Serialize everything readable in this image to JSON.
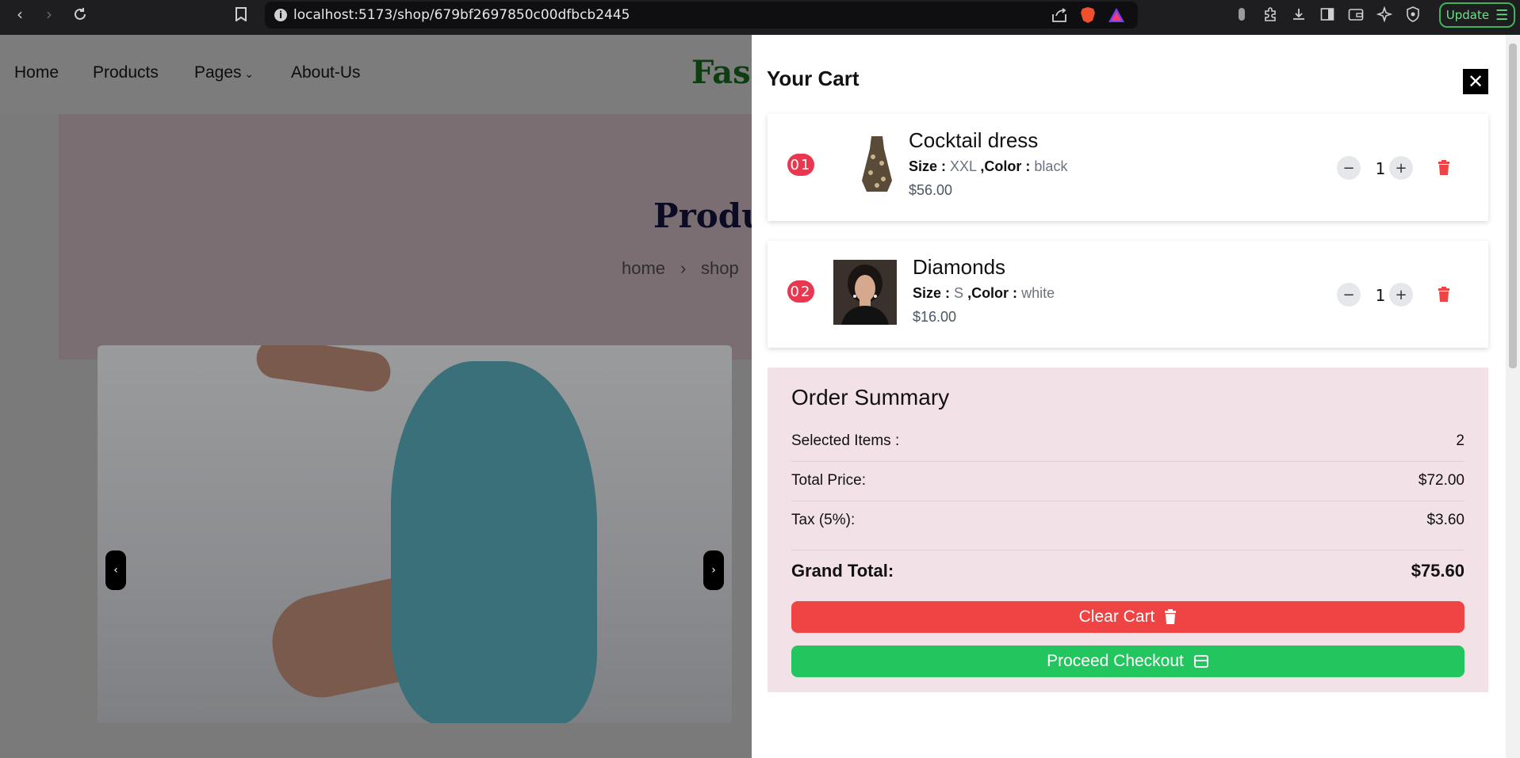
{
  "browser": {
    "url_host": "localhost",
    "url_rest": ":5173/shop/679bf2697850c00dfbcb2445",
    "update_label": "Update"
  },
  "nav": {
    "home": "Home",
    "products": "Products",
    "pages": "Pages",
    "about": "About-Us",
    "logo": "Fash"
  },
  "hero": {
    "title": "Produc",
    "breadcrumb_home": "home",
    "breadcrumb_sep": "›",
    "breadcrumb_shop": "shop"
  },
  "slider": {
    "prev": "‹",
    "next": "›"
  },
  "cart": {
    "title": "Your Cart",
    "items": [
      {
        "index": "01",
        "name": "Cocktail dress",
        "size_label": "Size :",
        "size": "XXL",
        "color_label": ",Color :",
        "color": "black",
        "price": "$56.00",
        "qty": "1"
      },
      {
        "index": "02",
        "name": "Diamonds",
        "size_label": "Size :",
        "size": "S",
        "color_label": ",Color :",
        "color": "white",
        "price": "$16.00",
        "qty": "1"
      }
    ],
    "qty_minus": "−",
    "qty_plus": "+"
  },
  "summary": {
    "title": "Order Summary",
    "selected_label": "Selected Items :",
    "selected_value": "2",
    "total_label": "Total Price:",
    "total_value": "$72.00",
    "tax_label": "Tax (5%):",
    "tax_value": "$3.60",
    "grand_label": "Grand Total:",
    "grand_value": "$75.60",
    "clear_label": "Clear Cart",
    "checkout_label": "Proceed Checkout"
  },
  "colors": {
    "clear_button": "#ef4444",
    "checkout_button": "#22c55e",
    "index_badge": "#e8384f",
    "summary_bg": "#f3e1e8"
  }
}
